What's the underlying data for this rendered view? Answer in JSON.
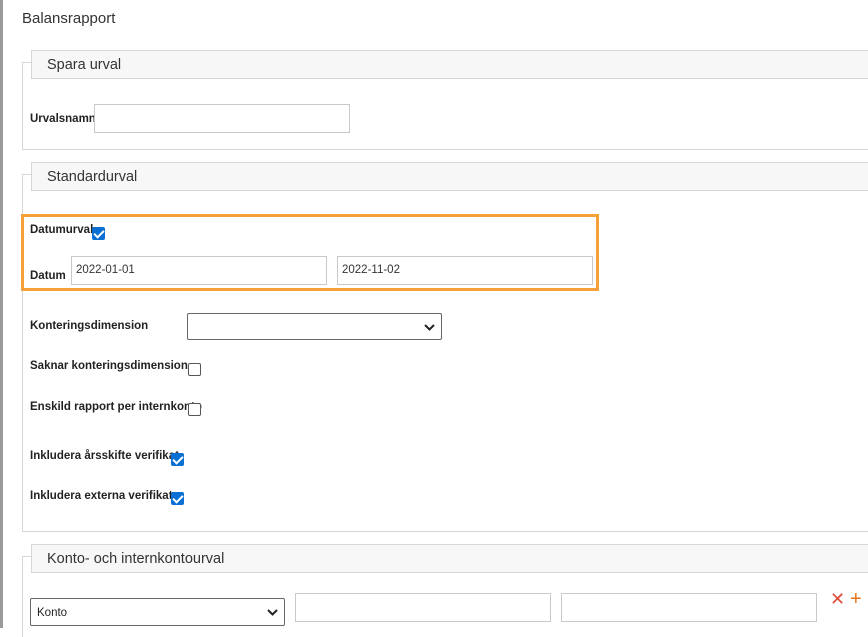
{
  "page": {
    "title": "Balansrapport"
  },
  "spara_urval": {
    "heading": "Spara urval",
    "urvalsnamn_label": "Urvalsnamn",
    "urvalsnamn_value": ""
  },
  "standardurval": {
    "heading": "Standardurval",
    "datumurval_label": "Datumurval",
    "datumurval_checked": true,
    "datum_label": "Datum",
    "date_from": "2022-01-01",
    "date_to": "2022-11-02",
    "konteringsdimension_label": "Konteringsdimension",
    "konteringsdimension_value": "",
    "saknar_label": "Saknar konteringsdimension",
    "saknar_checked": false,
    "enskild_label": "Enskild rapport per internkonto",
    "enskild_checked": false,
    "arsskifte_label": "Inkludera årsskifte verifikat",
    "arsskifte_checked": true,
    "externa_label": "Inkludera externa verifikat",
    "externa_checked": true
  },
  "kontourval": {
    "heading": "Konto- och internkontourval",
    "type_value": "Konto",
    "from_value": "",
    "to_value": "",
    "remove_icon": "close-icon",
    "add_icon": "plus-icon"
  },
  "colors": {
    "accent_highlight": "#f4a13a",
    "checkbox": "#0b70d4",
    "remove": "#e14c3a",
    "add": "#e8731a"
  }
}
